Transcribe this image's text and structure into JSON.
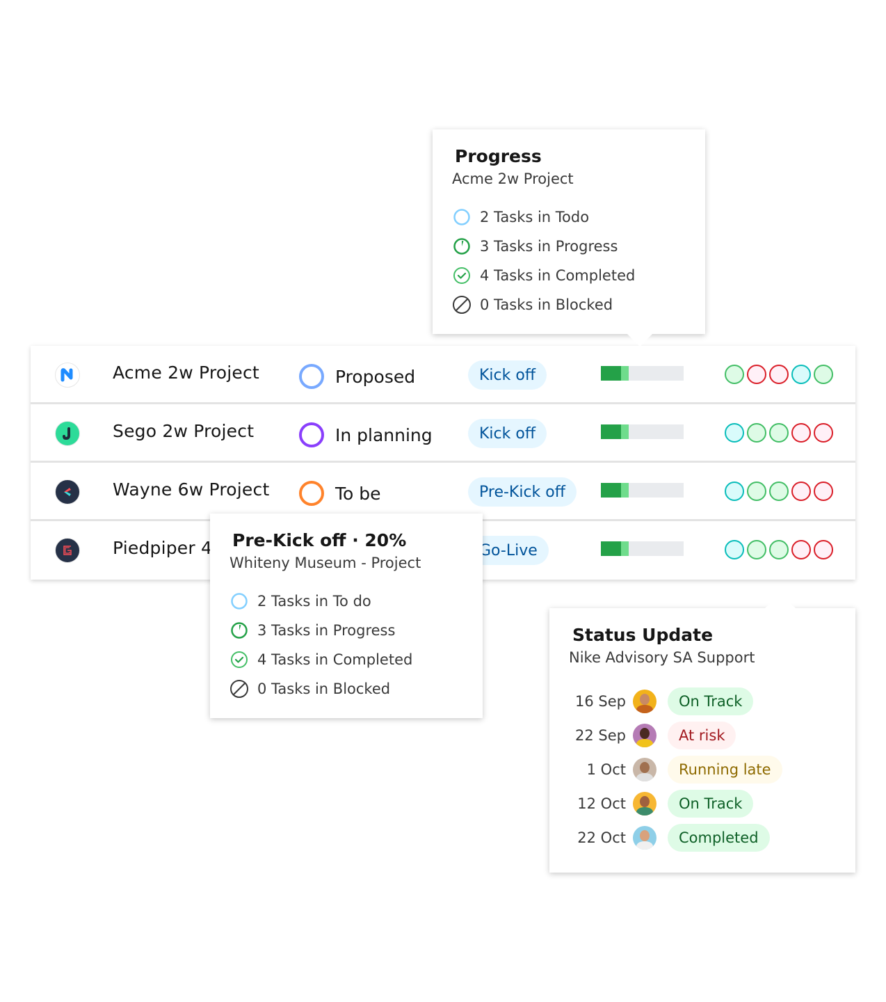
{
  "projects": [
    {
      "name": "Acme 2w Project",
      "logo": "n-logo-icon",
      "status": "Proposed",
      "status_color": "#78a9ff",
      "phase": "Kick off",
      "progress": {
        "completed_pct": 20,
        "in_progress_pct": 10
      },
      "health": [
        "green",
        "red",
        "red",
        "cyan",
        "green"
      ]
    },
    {
      "name": "Sego 2w Project",
      "logo": "j-logo-icon",
      "status": "In planning",
      "status_color": "#8a3ffc",
      "phase": "Kick off",
      "progress": {
        "completed_pct": 20,
        "in_progress_pct": 10
      },
      "health": [
        "cyan",
        "green",
        "green",
        "red",
        "red"
      ]
    },
    {
      "name": "Wayne 6w Project",
      "logo": "k-logo-icon",
      "status": "To be",
      "status_color": "#ff832b",
      "phase": "Pre-Kick off",
      "progress": {
        "completed_pct": 20,
        "in_progress_pct": 10
      },
      "health": [
        "cyan",
        "green",
        "green",
        "red",
        "red"
      ]
    },
    {
      "name": "Piedpiper 4",
      "logo": "g-logo-icon",
      "status": "",
      "status_color": "#78a9ff",
      "phase": "Go-Live",
      "progress": {
        "completed_pct": 20,
        "in_progress_pct": 10
      },
      "health": [
        "cyan",
        "green",
        "green",
        "red",
        "red"
      ]
    }
  ],
  "health_colors": {
    "green": {
      "border": "#42be65",
      "fill": "#defbe6"
    },
    "red": {
      "border": "#da1e28",
      "fill": "#fff0f7"
    },
    "cyan": {
      "border": "#08bdba",
      "fill": "#d9fbfb"
    }
  },
  "progress_tooltip": {
    "title": "Progress",
    "subtitle": "Acme 2w Project",
    "items": [
      {
        "icon": "todo-circle-icon",
        "label": "2 Tasks in Todo"
      },
      {
        "icon": "in-progress-icon",
        "label": "3 Tasks in Progress"
      },
      {
        "icon": "completed-check-icon",
        "label": "4 Tasks in Completed"
      },
      {
        "icon": "blocked-icon",
        "label": "0 Tasks in Blocked"
      }
    ]
  },
  "prekick_tooltip": {
    "title": "Pre-Kick off · 20%",
    "subtitle": "Whiteny Museum - Project",
    "items": [
      {
        "icon": "todo-circle-icon",
        "label": "2 Tasks in To do"
      },
      {
        "icon": "in-progress-icon",
        "label": "3 Tasks in Progress"
      },
      {
        "icon": "completed-check-icon",
        "label": "4 Tasks in Completed"
      },
      {
        "icon": "blocked-icon",
        "label": "0 Tasks in Blocked"
      }
    ]
  },
  "status_tooltip": {
    "title": "Status Update",
    "subtitle": "Nike Advisory SA Support",
    "updates": [
      {
        "date": "16 Sep",
        "status": "On Track",
        "kind": "ontrack"
      },
      {
        "date": "22 Sep",
        "status": "At risk",
        "kind": "atrisk"
      },
      {
        "date": "1 Oct",
        "status": "Running late",
        "kind": "late"
      },
      {
        "date": "12 Oct",
        "status": "On Track",
        "kind": "ontrack"
      },
      {
        "date": "22 Oct",
        "status": "Completed",
        "kind": "ontrack"
      }
    ]
  }
}
